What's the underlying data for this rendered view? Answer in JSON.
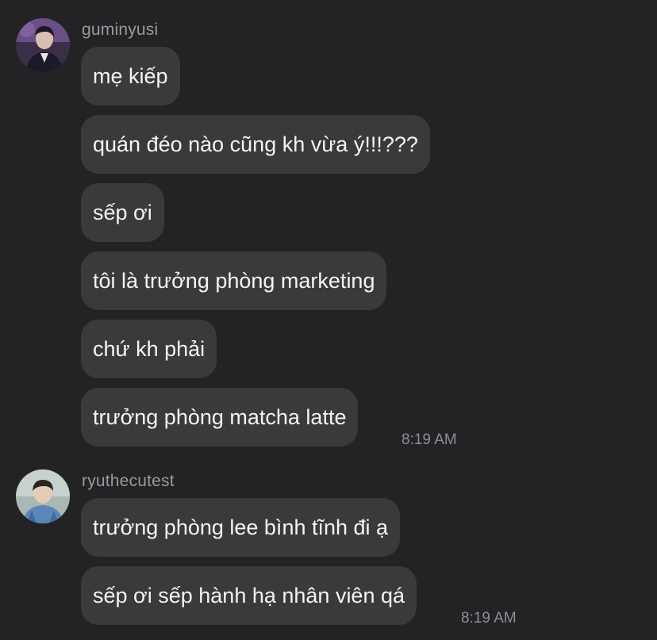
{
  "conversation": {
    "groups": [
      {
        "username": "guminyusi",
        "avatar": "user-avatar-photo",
        "messages": [
          "mẹ kiếp",
          "quán đéo nào cũng kh vừa ý!!!???",
          "sếp ơi",
          "tôi là trưởng phòng marketing",
          "chứ kh phải",
          "trưởng phòng matcha latte"
        ],
        "timestamp": "8:19 AM"
      },
      {
        "username": "ryuthecutest",
        "avatar": "user-avatar-photo",
        "messages": [
          "trưởng phòng lee bình tĩnh đi ạ",
          "sếp ơi sếp hành hạ nhân viên qá"
        ],
        "timestamp": "8:19 AM"
      }
    ]
  },
  "colors": {
    "background": "#232325",
    "bubble": "#3a3a3c",
    "username": "#9a9a9e",
    "timestamp": "#8e8e93",
    "text": "#f4f4f4"
  }
}
